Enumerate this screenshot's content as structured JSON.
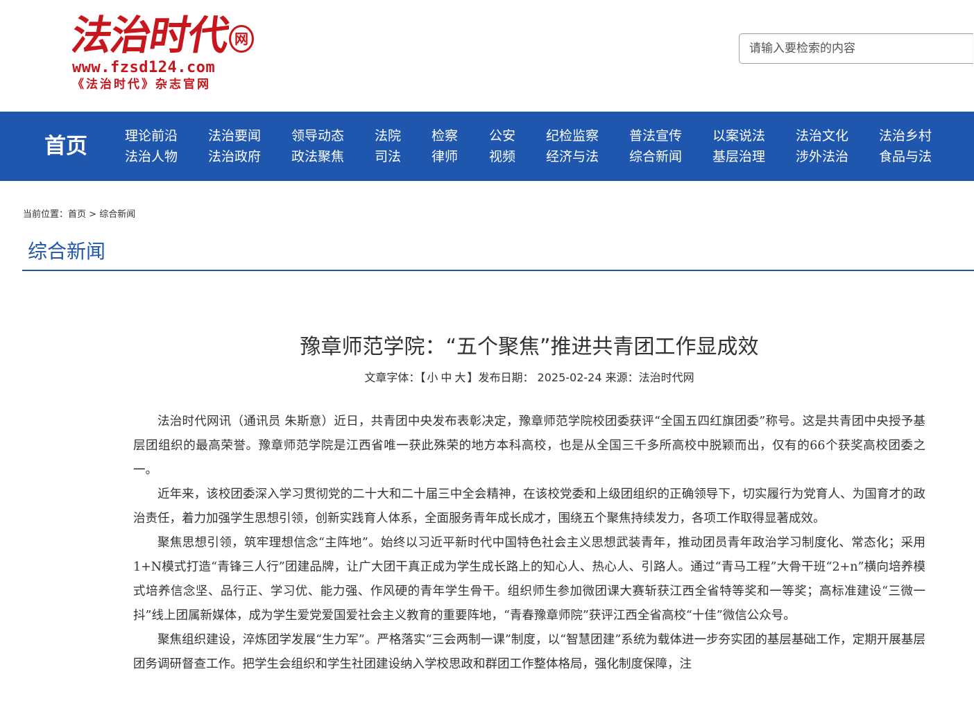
{
  "header": {
    "logo": {
      "title": "法治时代",
      "badge": "网",
      "url": "www.fzsd124.com",
      "subtitle": "《法治时代》杂志官网"
    },
    "search": {
      "placeholder": "请输入要检索的内容"
    }
  },
  "nav": {
    "home": "首页",
    "columns": [
      [
        "理论前沿",
        "法治人物"
      ],
      [
        "法治要闻",
        "法治政府"
      ],
      [
        "领导动态",
        "政法聚焦"
      ],
      [
        "法院",
        "司法"
      ],
      [
        "检察",
        "律师"
      ],
      [
        "公安",
        "视频"
      ],
      [
        "纪检监察",
        "经济与法"
      ],
      [
        "普法宣传",
        "综合新闻"
      ],
      [
        "以案说法",
        "基层治理"
      ],
      [
        "法治文化",
        "涉外法治"
      ],
      [
        "法治乡村",
        "食品与法"
      ]
    ]
  },
  "breadcrumb": {
    "prefix": "当前位置：",
    "home": "首页",
    "separator": " > ",
    "current": "综合新闻"
  },
  "section": {
    "title": "综合新闻"
  },
  "article": {
    "title": "豫章师范学院：“五个聚焦”推进共青团工作显成效",
    "meta": {
      "font_label": "文章字体：",
      "bracket_open": "【",
      "size_small": "小",
      "size_medium": "中",
      "size_large": "大",
      "bracket_close": "】",
      "date_label": "发布日期：",
      "date": "2025-02-24",
      "source_label": "来源：",
      "source": "法治时代网"
    },
    "paragraphs": [
      "法治时代网讯（通讯员 朱斯意）近日，共青团中央发布表彰决定，豫章师范学院校团委获评“全国五四红旗团委”称号。这是共青团中央授予基层团组织的最高荣誉。豫章师范学院是江西省唯一获此殊荣的地方本科高校，也是从全国三千多所高校中脱颖而出，仅有的66个获奖高校团委之一。",
      "近年来，该校团委深入学习贯彻党的二十大和二十届三中全会精神，在该校党委和上级团组织的正确领导下，切实履行为党育人、为国育才的政治责任，着力加强学生思想引领，创新实践育人体系，全面服务青年成长成才，围绕五个聚焦持续发力，各项工作取得显著成效。",
      "聚焦思想引领，筑牢理想信念“主阵地”。始终以习近平新时代中国特色社会主义思想武装青年，推动团员青年政治学习制度化、常态化；采用1+N模式打造“青锋三人行”团建品牌，让广大团干真正成为学生成长路上的知心人、热心人、引路人。通过“青马工程”大骨干班“2+n”横向培养模式培养信念坚、品行正、学习优、能力强、作风硬的青年学生骨干。组织师生参加微团课大赛斩获江西全省特等奖和一等奖；高标准建设“三微一抖”线上团属新媒体，成为学生爱党爱国爱社会主义教育的重要阵地，“青春豫章师院”获评江西全省高校“十佳”微信公众号。",
      "聚焦组织建设，淬炼团学发展“生力军”。严格落实“三会两制一课”制度，以“智慧团建”系统为载体进一步夯实团的基层基础工作，定期开展基层团务调研督查工作。把学生会组织和学生社团建设纳入学校思政和群团工作整体格局，强化制度保障，注"
    ]
  }
}
